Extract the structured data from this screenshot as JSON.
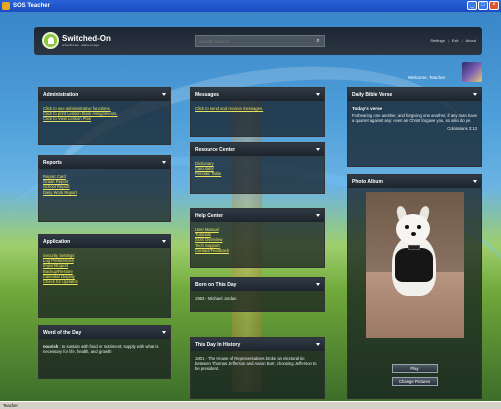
{
  "window": {
    "title": "SOS Teacher"
  },
  "header": {
    "logo_name": "Switched-On",
    "logo_tag": "schoolhouse · alpha omega",
    "search_placeholder": "Google Search",
    "links": [
      "Settings",
      "Exit",
      "About"
    ]
  },
  "welcome": {
    "text": "Welcome, Teacher"
  },
  "panels": {
    "administration": {
      "title": "Administration",
      "links": [
        "Click to see administrative functions.",
        "Click to print Lesson Book Assignments.",
        "Click to View Lesson Plan"
      ]
    },
    "reports": {
      "title": "Reports",
      "links": [
        "Report Card",
        "Grade Report",
        "School Report",
        "Daily Work Report"
      ]
    },
    "application": {
      "title": "Application",
      "links": [
        "Security Settings",
        "Log Preferences",
        "Import/Export",
        "Backup/Restore",
        "Calendar Display",
        "Check for Updates"
      ]
    },
    "word_of_day": {
      "title": "Word of the Day",
      "word": "nourish",
      "definition": ": to sustain with food or nutriment; supply with what is necessary for life, health, and growth"
    },
    "messages": {
      "title": "Messages",
      "link": "Click to send and receive messages."
    },
    "resource_center": {
      "title": "Resource Center",
      "links": [
        "Dictionary",
        "Calculator",
        "Periodic Table"
      ]
    },
    "help_center": {
      "title": "Help Center",
      "links": [
        "User Manual",
        "Tutorials",
        "SOS Overview",
        "Tech Support",
        "Contact/Feedback"
      ]
    },
    "born_on_day": {
      "title": "Born on This Day",
      "entry": "1963 - Michael Jordan"
    },
    "history": {
      "title": "This Day In History",
      "entry": "1801 - The House of Representatives broke an electoral tie between Thomas Jefferson and Aaron Burr, choosing Jefferson to be president."
    },
    "bible_verse": {
      "title": "Daily Bible Verse",
      "heading": "Today's verse",
      "text": "Forbearing one another, and forgiving one another, if any man have a quarrel against any: even as Christ forgave you, so also do ye.",
      "reference": "Colossians 3:13"
    },
    "photo_album": {
      "title": "Photo Album",
      "play_label": "Play",
      "change_label": "Change Pictures"
    }
  },
  "status": {
    "text": "Teacher"
  }
}
